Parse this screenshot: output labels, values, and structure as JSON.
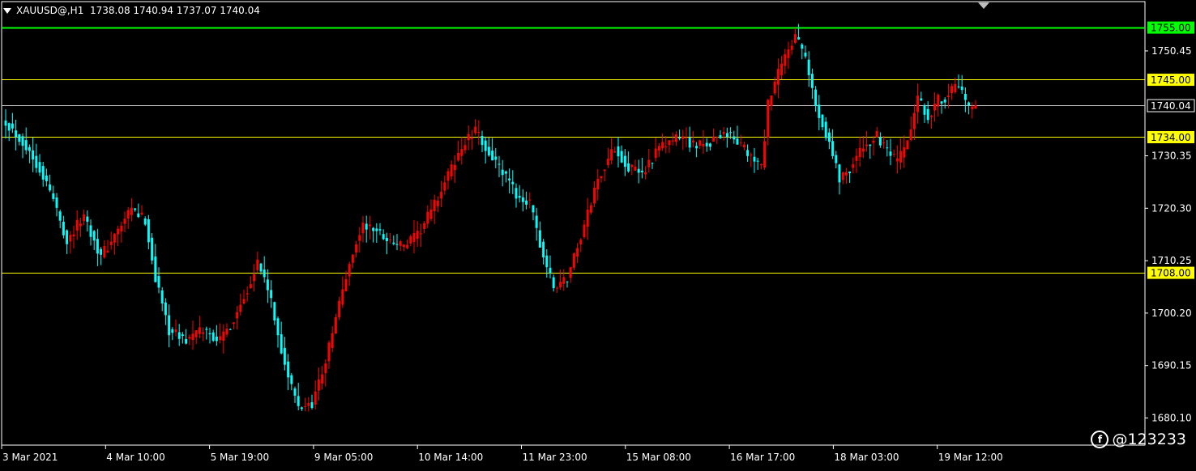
{
  "header": {
    "symbol": "XAUUSD@,H1",
    "ohlc": "1738.08 1740.94 1737.07 1740.04"
  },
  "watermark": "@123233",
  "colors": {
    "background": "#000000",
    "bull": "#ff0000",
    "bear": "#00ffff",
    "grid_axis": "#ffffff",
    "level_yellow": "#ffff00",
    "level_green": "#00ff00",
    "price_line": "#c0c0c0"
  },
  "chart_data": {
    "type": "candlestick",
    "ylim": [
      1674.9,
      1759.9
    ],
    "y_ticks": [
      "1750.45",
      "1730.35",
      "1720.30",
      "1710.25",
      "1700.20",
      "1690.15",
      "1680.10"
    ],
    "x_tick_labels": [
      "3 Mar 2021",
      "4 Mar 10:00",
      "5 Mar 19:00",
      "9 Mar 05:00",
      "10 Mar 14:00",
      "11 Mar 23:00",
      "15 Mar 08:00",
      "16 Mar 17:00",
      "18 Mar 03:00",
      "19 Mar 12:00"
    ],
    "levels": [
      {
        "price": 1755.0,
        "label": "1755.00",
        "color": "#00ff00"
      },
      {
        "price": 1745.0,
        "label": "1745.00",
        "color": "#ffff00"
      },
      {
        "price": 1734.0,
        "label": "1734.00",
        "color": "#ffff00"
      },
      {
        "price": 1708.0,
        "label": "1708.00",
        "color": "#ffff00"
      }
    ],
    "current_price": {
      "price": 1740.04,
      "label": "1740.04"
    },
    "close_path": [
      [
        0,
        1737
      ],
      [
        5,
        1733
      ],
      [
        10,
        1728
      ],
      [
        14,
        1722
      ],
      [
        18,
        1714
      ],
      [
        23,
        1719
      ],
      [
        28,
        1711
      ],
      [
        33,
        1716
      ],
      [
        37,
        1720
      ],
      [
        41,
        1718
      ],
      [
        44,
        1707
      ],
      [
        48,
        1697
      ],
      [
        53,
        1695
      ],
      [
        58,
        1697
      ],
      [
        63,
        1695
      ],
      [
        67,
        1699
      ],
      [
        71,
        1705
      ],
      [
        74,
        1710
      ],
      [
        77,
        1705
      ],
      [
        80,
        1696
      ],
      [
        83,
        1688
      ],
      [
        86,
        1682
      ],
      [
        90,
        1683
      ],
      [
        94,
        1691
      ],
      [
        98,
        1702
      ],
      [
        102,
        1712
      ],
      [
        105,
        1717
      ],
      [
        109,
        1716
      ],
      [
        113,
        1714
      ],
      [
        117,
        1713
      ],
      [
        121,
        1715
      ],
      [
        126,
        1721
      ],
      [
        131,
        1728
      ],
      [
        135,
        1733
      ],
      [
        138,
        1735
      ],
      [
        142,
        1731
      ],
      [
        146,
        1727
      ],
      [
        150,
        1723
      ],
      [
        154,
        1721
      ],
      [
        158,
        1711
      ],
      [
        161,
        1705
      ],
      [
        165,
        1707
      ],
      [
        170,
        1717
      ],
      [
        174,
        1726
      ],
      [
        179,
        1732
      ],
      [
        183,
        1728
      ],
      [
        187,
        1727
      ],
      [
        191,
        1731
      ],
      [
        195,
        1733
      ],
      [
        199,
        1734
      ],
      [
        203,
        1732
      ],
      [
        207,
        1733
      ],
      [
        211,
        1735
      ],
      [
        215,
        1733
      ],
      [
        219,
        1730
      ],
      [
        222,
        1728
      ],
      [
        224,
        1740
      ],
      [
        227,
        1746
      ],
      [
        230,
        1751
      ],
      [
        232,
        1753
      ],
      [
        235,
        1749
      ],
      [
        238,
        1740
      ],
      [
        242,
        1733
      ],
      [
        245,
        1726
      ],
      [
        248,
        1728
      ],
      [
        252,
        1732
      ],
      [
        256,
        1734
      ],
      [
        259,
        1731
      ],
      [
        262,
        1729
      ],
      [
        265,
        1733
      ],
      [
        268,
        1741
      ],
      [
        271,
        1738
      ],
      [
        274,
        1741
      ],
      [
        277,
        1742
      ],
      [
        280,
        1744
      ],
      [
        283,
        1739
      ],
      [
        285,
        1740.04
      ]
    ]
  }
}
